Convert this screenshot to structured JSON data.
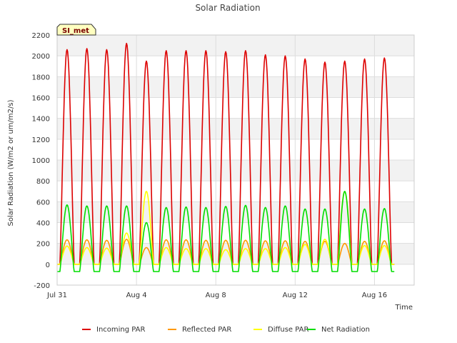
{
  "chart_data": {
    "type": "line",
    "title": "Solar Radiation",
    "xlabel": "Time",
    "ylabel": "Solar Radiation (W/m2 or um/m2/s)",
    "badge": "SI_met",
    "xlim": [
      0,
      18
    ],
    "ylim": [
      -200,
      2200
    ],
    "y_ticks": [
      -200,
      0,
      200,
      400,
      600,
      800,
      1000,
      1200,
      1400,
      1600,
      1800,
      2000,
      2200
    ],
    "x_ticks": [
      {
        "day": 0,
        "label": "Jul 31"
      },
      {
        "day": 4,
        "label": "Aug 4"
      },
      {
        "day": 8,
        "label": "Aug 8"
      },
      {
        "day": 12,
        "label": "Aug 12"
      },
      {
        "day": 16,
        "label": "Aug 16"
      }
    ],
    "grid": true,
    "legend_position": "bottom",
    "day_offsets": [
      0.5,
      1.5,
      2.5,
      3.5,
      4.5,
      5.5,
      6.5,
      7.5,
      8.5,
      9.5,
      10.5,
      11.5,
      12.5,
      13.5,
      14.5,
      15.5,
      16.5
    ],
    "series": [
      {
        "name": "Incoming PAR",
        "color": "#dd0000",
        "daily_peaks": [
          2060,
          2070,
          2060,
          2120,
          1950,
          2050,
          2050,
          2050,
          2040,
          2050,
          2010,
          2000,
          1970,
          1940,
          1950,
          1970,
          1980
        ]
      },
      {
        "name": "Reflected PAR",
        "color": "#ff9900",
        "daily_peaks": [
          235,
          235,
          230,
          240,
          160,
          235,
          235,
          230,
          230,
          230,
          225,
          225,
          220,
          220,
          200,
          220,
          225
        ]
      },
      {
        "name": "Diffuse PAR",
        "color": "#ffff00",
        "daily_peaks": [
          175,
          160,
          155,
          300,
          700,
          160,
          150,
          150,
          140,
          150,
          150,
          160,
          190,
          240,
          700,
          180,
          180
        ]
      },
      {
        "name": "Net Radiation",
        "color": "#00dd00",
        "daily_peaks": [
          570,
          560,
          560,
          560,
          400,
          545,
          550,
          545,
          555,
          565,
          545,
          560,
          530,
          530,
          700,
          530,
          535
        ],
        "night_value": -70
      }
    ]
  }
}
